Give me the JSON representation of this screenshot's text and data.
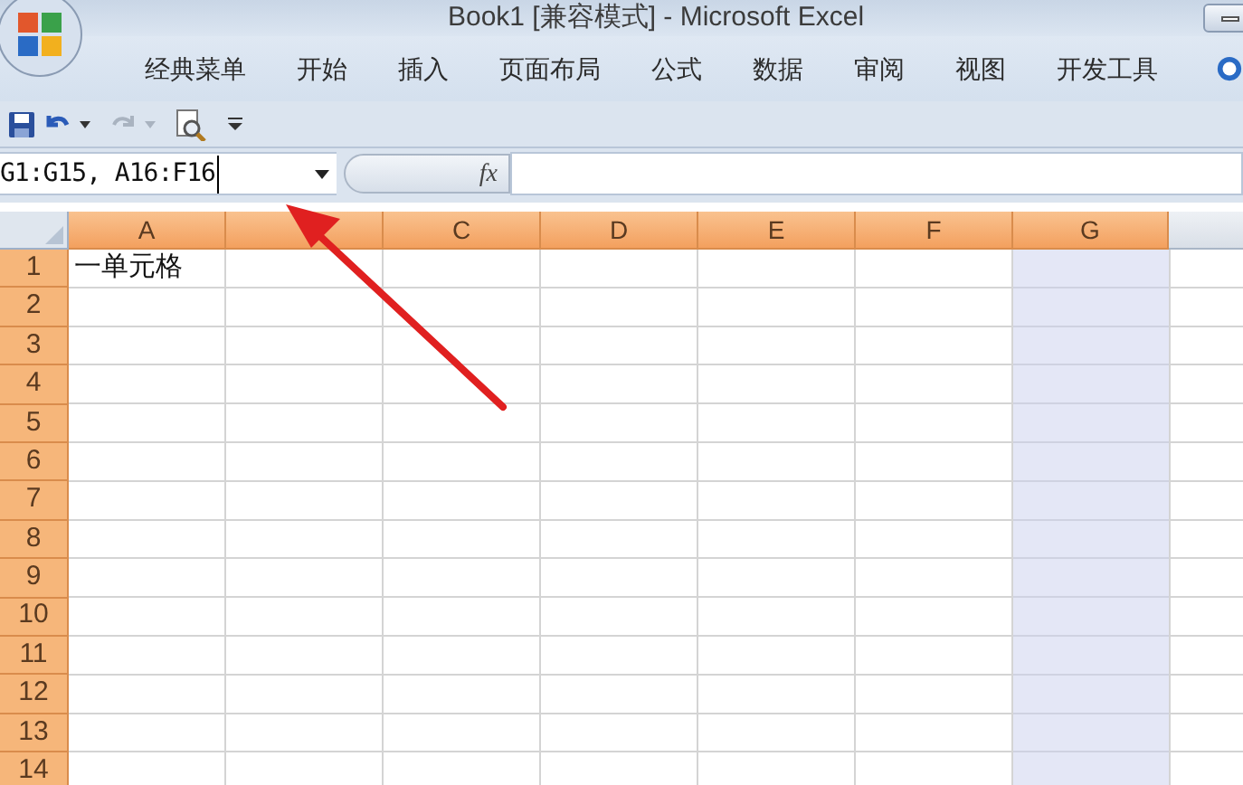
{
  "window": {
    "title": "Book1  [兼容模式] - Microsoft Excel"
  },
  "ribbon_tabs": [
    {
      "label": "经典菜单",
      "selected": false
    },
    {
      "label": "开始",
      "selected": false
    },
    {
      "label": "插入",
      "selected": false
    },
    {
      "label": "页面布局",
      "selected": false
    },
    {
      "label": "公式",
      "selected": false
    },
    {
      "label": "数据",
      "selected": false
    },
    {
      "label": "审阅",
      "selected": false
    },
    {
      "label": "视图",
      "selected": false
    },
    {
      "label": "开发工具",
      "selected": false
    }
  ],
  "name_box": {
    "value": "G1:G15, A16:F16"
  },
  "formula_bar": {
    "fx": "fx"
  },
  "columns": [
    {
      "label": "A",
      "selected": true,
      "cells_selected": false
    },
    {
      "selected": true,
      "cells_selected": false
    },
    {
      "label": "C",
      "selected": true,
      "cells_selected": false
    },
    {
      "label": "D",
      "selected": true,
      "cells_selected": false
    },
    {
      "label": "E",
      "selected": true,
      "cells_selected": false
    },
    {
      "label": "F",
      "selected": true,
      "cells_selected": false
    },
    {
      "label": "G",
      "selected": true,
      "cells_selected": true
    },
    {
      "selected": false,
      "cells_selected": false
    }
  ],
  "rows": [
    {
      "label": "1",
      "selected": true,
      "cells": [
        "一单元格"
      ]
    },
    {
      "label": "2",
      "selected": true
    },
    {
      "label": "3",
      "selected": true
    },
    {
      "label": "4",
      "selected": true
    },
    {
      "label": "5",
      "selected": true
    },
    {
      "label": "6",
      "selected": true
    },
    {
      "label": "7",
      "selected": true
    },
    {
      "label": "8",
      "selected": true
    },
    {
      "label": "9",
      "selected": true
    },
    {
      "label": "10",
      "selected": true
    },
    {
      "label": "11",
      "selected": true
    },
    {
      "label": "12",
      "selected": true
    },
    {
      "label": "13",
      "selected": true
    },
    {
      "label": "14",
      "selected": true
    }
  ]
}
